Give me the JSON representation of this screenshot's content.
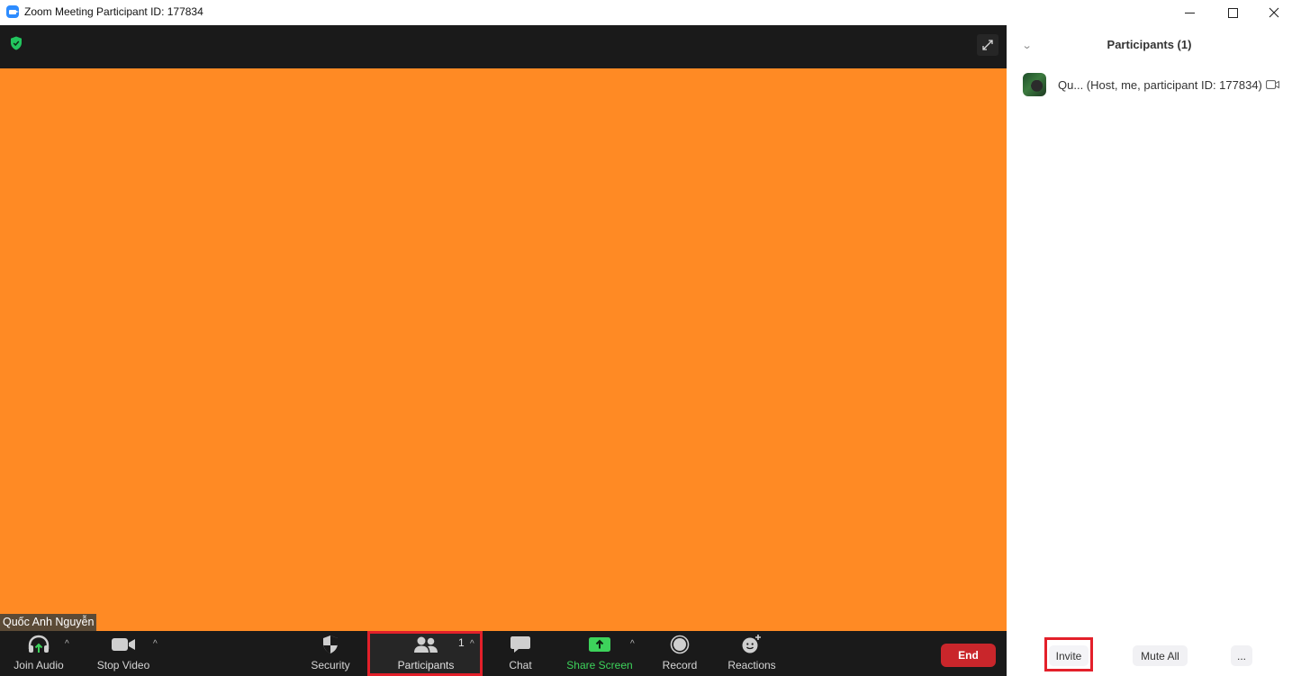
{
  "window": {
    "title": "Zoom Meeting Participant ID: 177834",
    "app_icon": "zoom-camera-icon",
    "controls": [
      "minimize",
      "maximize",
      "close"
    ]
  },
  "video": {
    "encryption_icon": "green-shield-check-icon",
    "fullscreen_icon": "expand-arrows-icon",
    "background_color": "#ff8a24",
    "name_tag": "Quốc Anh Nguyễn"
  },
  "toolbar": {
    "join_audio": {
      "label": "Join Audio",
      "icon": "headphones-up-arrow-icon"
    },
    "stop_video": {
      "label": "Stop Video",
      "icon": "video-camera-icon"
    },
    "security": {
      "label": "Security",
      "icon": "shield-icon"
    },
    "participants": {
      "label": "Participants",
      "count": "1",
      "icon": "people-icon"
    },
    "chat": {
      "label": "Chat",
      "icon": "chat-bubble-icon"
    },
    "share_screen": {
      "label": "Share Screen",
      "icon": "share-up-arrow-icon",
      "color": "#3dd35b"
    },
    "record": {
      "label": "Record",
      "icon": "record-circle-icon"
    },
    "reactions": {
      "label": "Reactions",
      "icon": "smiley-plus-icon"
    },
    "end": {
      "label": "End",
      "color": "#c9262b"
    },
    "highlight_color": "#e3202a"
  },
  "panel": {
    "title": "Participants (1)",
    "participants": [
      {
        "name": "Qu...",
        "details": " (Host, me, participant ID: 177834)",
        "video_icon": "video-off-icon"
      }
    ],
    "footer": {
      "invite": "Invite",
      "mute_all": "Mute All",
      "more": "..."
    }
  }
}
